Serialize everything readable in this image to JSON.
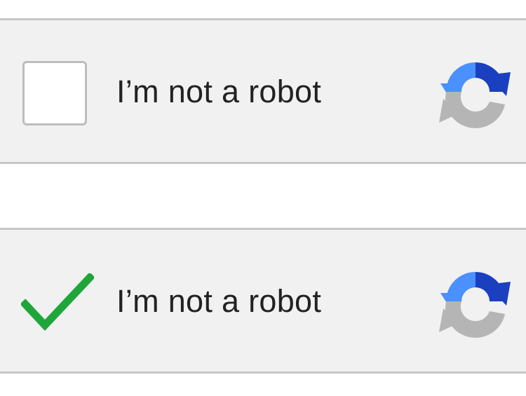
{
  "widgets": [
    {
      "state": "unchecked",
      "label": "I’m not a robot",
      "checkbox_icon": "empty-checkbox",
      "logo_icon": "recaptcha-logo-icon"
    },
    {
      "state": "checked",
      "label": "I’m not a robot",
      "checkbox_icon": "checkmark-icon",
      "logo_icon": "recaptcha-logo-icon"
    }
  ],
  "colors": {
    "panel_background": "#f1f1f1",
    "panel_border": "#c7c7c7",
    "checkbox_border": "#bdbdbd",
    "checkmark": "#1fa63b",
    "logo_light_blue": "#4a90ff",
    "logo_dark_blue": "#1a3fbf",
    "logo_gray": "#b5b5b5",
    "label_text": "#222222"
  }
}
